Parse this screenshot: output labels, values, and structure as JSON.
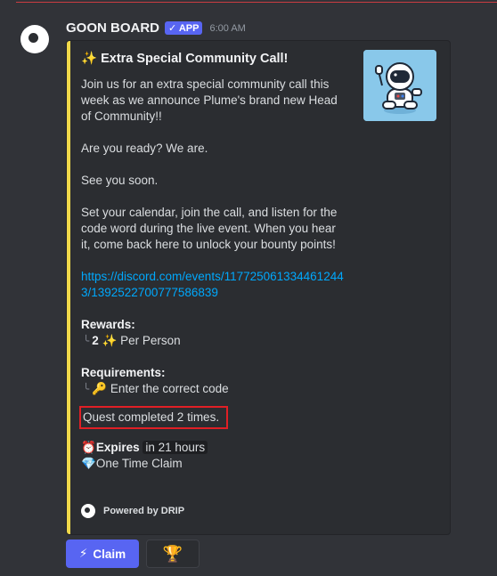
{
  "message": {
    "username": "GOON BOARD",
    "app_badge": "✓ APP",
    "time": "6:00 AM"
  },
  "embed": {
    "accent_color": "#f0d94a",
    "title": "✨ Extra Special Community Call!",
    "paragraphs": [
      "Join us for an extra special community call this week as we announce Plume's brand new Head of Community!!",
      "Are you ready? We are.",
      "See you soon.",
      "Set your calendar, join the call, and listen for the code word during the live event. When you hear it, come back here to unlock your bounty points!"
    ],
    "link": "https://discord.com/events/1177250613344612443/1392522700777586839",
    "rewards_label": "Rewards:",
    "rewards_amount": "2",
    "rewards_icon": "✨",
    "rewards_text": "Per Person",
    "requirements_label": "Requirements:",
    "requirements_icon": "🔑",
    "requirements_text": "Enter the correct code",
    "quest_status": "Quest completed 2 times.",
    "expires_icon": "⏰",
    "expires_label": "Expires",
    "expires_value": "in 21 hours",
    "claim_type_icon": "💎",
    "claim_type_text": "One Time Claim",
    "footer": "Powered by DRIP",
    "thumbnail": "astronaut-illustration"
  },
  "buttons": {
    "claim_icon": "⚡",
    "claim_label": "Claim",
    "trophy_icon": "🏆"
  }
}
